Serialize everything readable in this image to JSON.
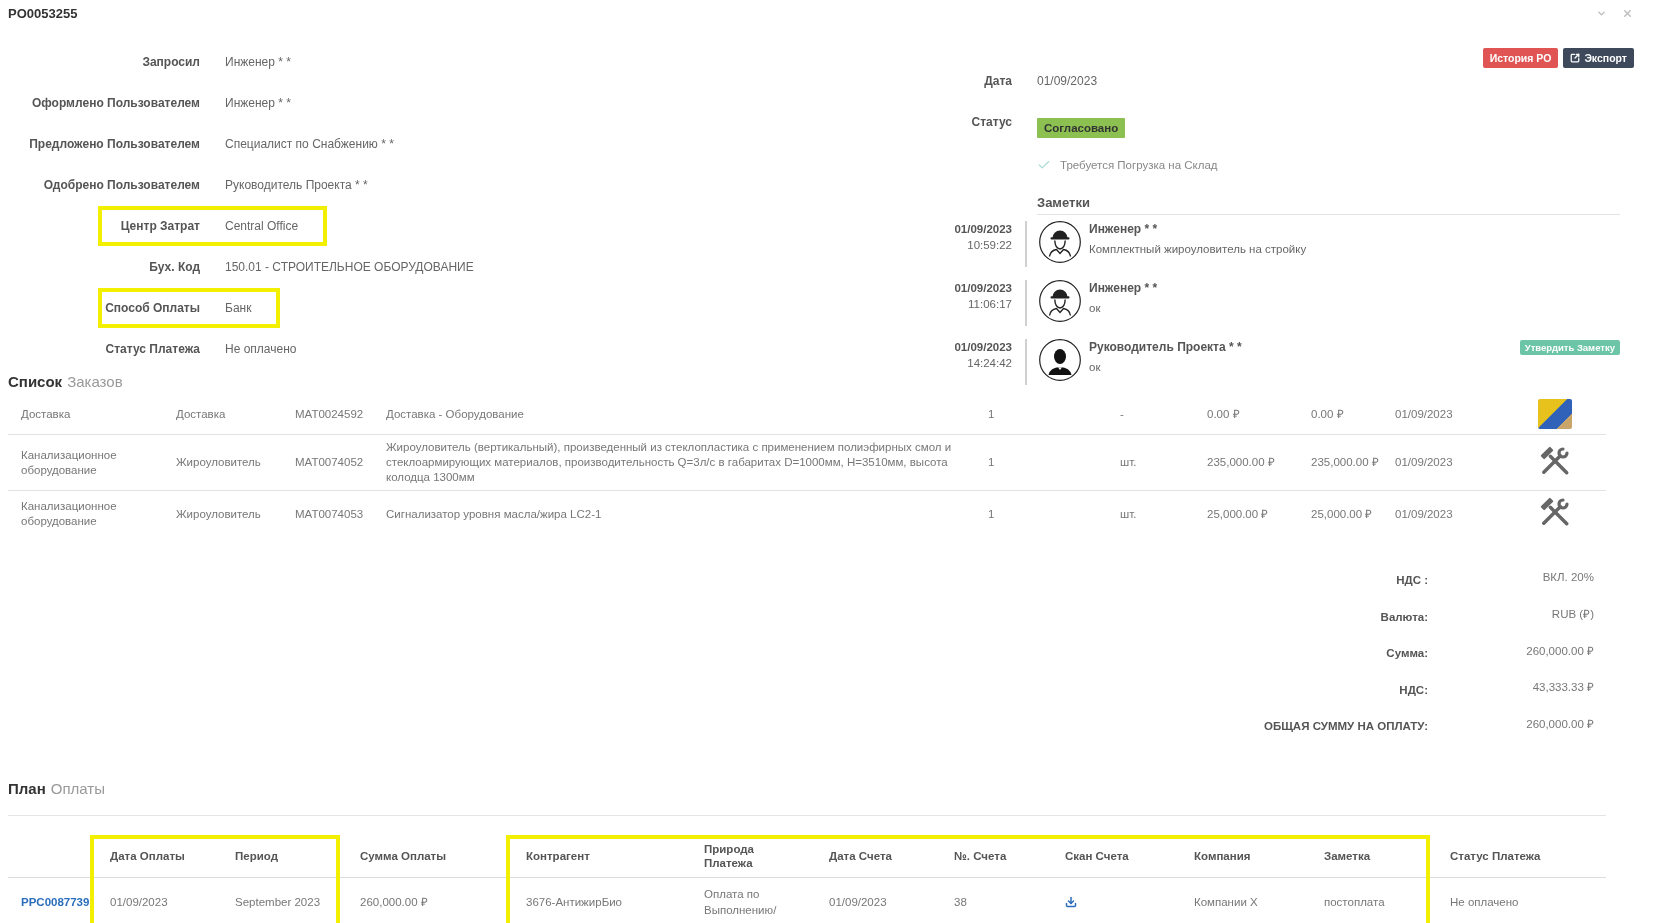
{
  "window": {
    "title": "PO0053255"
  },
  "header_actions": [
    {
      "label": "История РО",
      "kind": "history"
    },
    {
      "label": "Экспорт",
      "kind": "export"
    }
  ],
  "details": [
    {
      "label": "Запросил",
      "value": "Инженер * *",
      "highlighted": false
    },
    {
      "label": "Оформлено Пользователем",
      "value": "Инженер * *",
      "highlighted": false
    },
    {
      "label": "Предложено Пользователем",
      "value": "Специалист по Снабжению * *",
      "highlighted": false
    },
    {
      "label": "Одобрено Пользователем",
      "value": "Руководитель Проекта * *",
      "highlighted": false
    },
    {
      "label": "Центр Затрат",
      "value": "Central Office",
      "highlighted": true
    },
    {
      "label": "Бух. Код",
      "value": "150.01 - СТРОИТЕЛЬНОЕ ОБОРУДОВАНИЕ",
      "highlighted": false
    },
    {
      "label": "Способ Оплаты",
      "value": "Банк",
      "highlighted": true
    },
    {
      "label": "Статус Платежа",
      "value": "Не оплачено",
      "highlighted": false
    }
  ],
  "summary": {
    "date_label": "Дата",
    "date": "01/09/2023",
    "status_label": "Статус",
    "status": "Согласовано",
    "warehouse_loading": {
      "label": "Требуется Погрузка на Склад",
      "checked": true
    }
  },
  "notes": {
    "title": "Заметки",
    "items": [
      {
        "date": "01/09/2023",
        "time": "10:59:22",
        "kind": "worker",
        "author": "Инженер * *",
        "text": "Комплектный жироуловитель на стройку"
      },
      {
        "date": "01/09/2023",
        "time": "11:06:17",
        "kind": "worker",
        "author": "Инженер * *",
        "text": "ок"
      },
      {
        "date": "01/09/2023",
        "time": "14:24:42",
        "kind": "manager",
        "author": "Руководитель Проекта * *",
        "text": "ок",
        "action": "Утвердить Заметку"
      }
    ]
  },
  "order_list": {
    "title": "Список",
    "subtitle": "Заказов",
    "rows": [
      {
        "kind": "photo",
        "cells": [
          "Доставка",
          "Доставка",
          "MAT0024592",
          "Доставка - Оборудование",
          "1",
          "-",
          "0.00 ₽",
          "0.00 ₽",
          "01/09/2023"
        ]
      },
      {
        "kind": "tools",
        "cells": [
          "Канализационное оборудование",
          "Жироуловитель",
          "MAT0074052",
          "Жироуловитель (вертикальный), произведенный из стеклопластика с применением полиэфирных смол и стеклоармирующих материалов, производительность Q=3л/с в габаритах D=1000мм, H=3510мм, высота колодца 1300мм",
          "1",
          "шт.",
          "235,000.00 ₽",
          "235,000.00 ₽",
          "01/09/2023"
        ]
      },
      {
        "kind": "tools",
        "cells": [
          "Канализационное оборудование",
          "Жироуловитель",
          "MAT0074053",
          "Сигнализатор уровня масла/жира LC2-1",
          "1",
          "шт.",
          "25,000.00 ₽",
          "25,000.00 ₽",
          "01/09/2023"
        ]
      }
    ]
  },
  "totals": [
    {
      "label": "НДС :",
      "value": "ВКЛ. 20%"
    },
    {
      "label": "Валюта:",
      "value": "RUB (₽)"
    },
    {
      "label": "Сумма:",
      "value": "260,000.00 ₽"
    },
    {
      "label": "НДС:",
      "value": "43,333.33 ₽"
    },
    {
      "label": "ОБЩАЯ СУММУ НА ОПЛАТУ:",
      "value": "260,000.00 ₽"
    }
  ],
  "payment_plan": {
    "title": "План",
    "subtitle": "Оплаты",
    "column_groups": [
      {
        "highlighted": true,
        "columns": [
          {
            "label": "Дата Оплаты"
          },
          {
            "label": "Период"
          }
        ]
      },
      {
        "highlighted": false,
        "columns": [
          {
            "label": "Сумма Оплаты"
          }
        ]
      },
      {
        "highlighted": true,
        "columns": [
          {
            "label": "Контрагент"
          },
          {
            "label": "Природа Платежа"
          },
          {
            "label": "Дата Счета"
          },
          {
            "label": "№. Счета"
          },
          {
            "label": "Скан Счета"
          },
          {
            "label": "Компания"
          },
          {
            "label": "Заметка"
          }
        ]
      },
      {
        "highlighted": false,
        "columns": [
          {
            "label": "Статус Платежа"
          }
        ]
      }
    ],
    "rows": [
      {
        "id": "PPC0087739",
        "cells": [
          {
            "kind": "text",
            "text": "01/09/2023"
          },
          {
            "kind": "text",
            "text": "September 2023"
          },
          {
            "kind": "text",
            "text": "260,000.00 ₽"
          },
          {
            "kind": "text",
            "text": "3676-АнтижирБио"
          },
          {
            "kind": "text",
            "text": "Оплата по Выполнению/"
          },
          {
            "kind": "text",
            "text": "01/09/2023"
          },
          {
            "kind": "text",
            "text": "38"
          },
          {
            "kind": "download"
          },
          {
            "kind": "text",
            "text": "Компании X"
          },
          {
            "kind": "text",
            "text": "постоплата"
          },
          {
            "kind": "text",
            "text": "Не оплачено"
          }
        ]
      }
    ]
  }
}
